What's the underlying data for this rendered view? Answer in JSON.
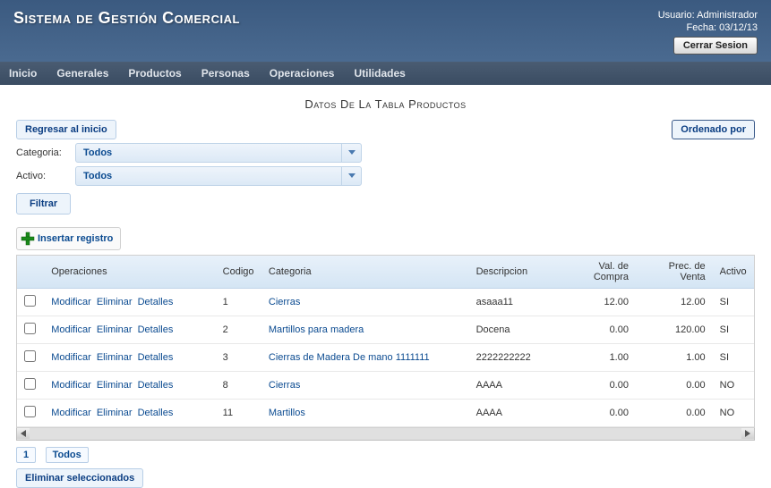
{
  "header": {
    "title": "Sistema de Gestión Comercial",
    "user_label": "Usuario: Administrador",
    "date_label": "Fecha: 03/12/13",
    "logout": "Cerrar Sesion"
  },
  "menu": {
    "items": [
      "Inicio",
      "Generales",
      "Productos",
      "Personas",
      "Operaciones",
      "Utilidades"
    ]
  },
  "page": {
    "title": "Datos De La Tabla Productos"
  },
  "actions": {
    "back": "Regresar al inicio",
    "filter": "Filtrar",
    "sort": "Ordenado por",
    "insert": "Insertar registro",
    "delete_selected": "Eliminar seleccionados"
  },
  "filters": {
    "categoria_label": "Categoria:",
    "categoria_value": "Todos",
    "activo_label": "Activo:",
    "activo_value": "Todos"
  },
  "table": {
    "ops_labels": {
      "mod": "Modificar",
      "del": "Eliminar",
      "det": "Detalles"
    },
    "headers": {
      "ops": "Operaciones",
      "codigo": "Codigo",
      "categoria": "Categoria",
      "descripcion": "Descripcion",
      "compra": "Val. de Compra",
      "venta": "Prec. de Venta",
      "activo": "Activo"
    },
    "rows": [
      {
        "codigo": "1",
        "categoria": "Cierras",
        "descripcion": "asaaa11",
        "compra": "12.00",
        "venta": "12.00",
        "activo": "SI"
      },
      {
        "codigo": "2",
        "categoria": "Martillos para madera",
        "descripcion": "Docena",
        "compra": "0.00",
        "venta": "120.00",
        "activo": "SI"
      },
      {
        "codigo": "3",
        "categoria": "Cierras de Madera De mano 1111111",
        "descripcion": "2222222222",
        "compra": "1.00",
        "venta": "1.00",
        "activo": "SI"
      },
      {
        "codigo": "8",
        "categoria": "Cierras",
        "descripcion": "AAAA",
        "compra": "0.00",
        "venta": "0.00",
        "activo": "NO"
      },
      {
        "codigo": "11",
        "categoria": "Martillos",
        "descripcion": "AAAA",
        "compra": "0.00",
        "venta": "0.00",
        "activo": "NO"
      }
    ]
  },
  "pager": {
    "page": "1",
    "all": "Todos"
  }
}
